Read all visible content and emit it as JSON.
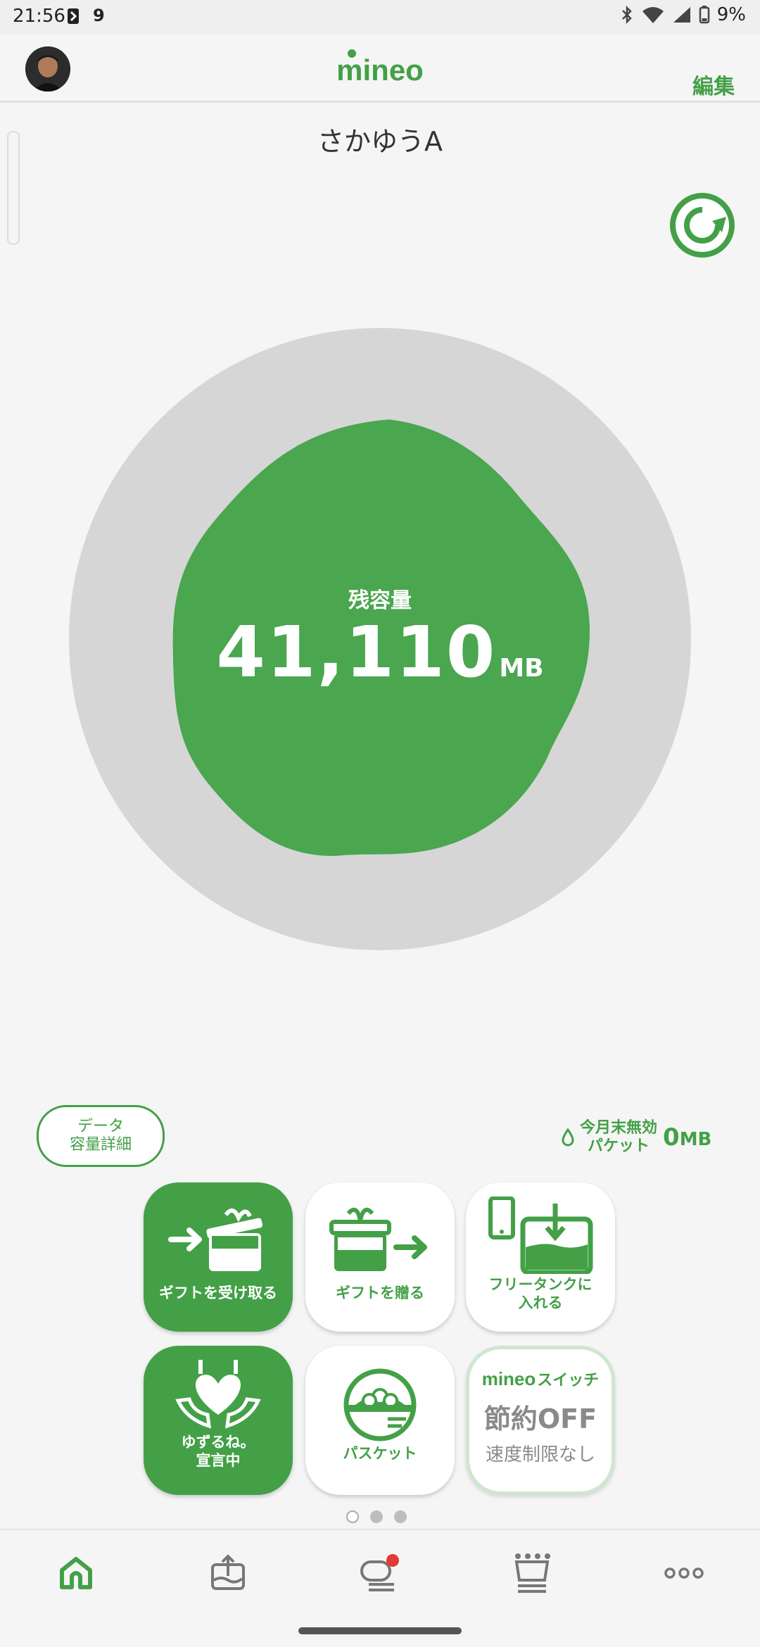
{
  "status_bar": {
    "time": "21:56",
    "notification_count": "9",
    "battery_percent": "9%"
  },
  "header": {
    "logo_text": "mineo",
    "edit_label": "編集"
  },
  "line": {
    "name": "さかゆうA"
  },
  "gauge": {
    "label": "残容量",
    "value": "41,110",
    "unit": "MB",
    "colors": {
      "fill": "#4aa64f",
      "ring": "#d6d6d6"
    }
  },
  "detail_button": {
    "line1": "データ",
    "line2": "容量詳細"
  },
  "invalid_packet": {
    "label_line1": "今月末無効",
    "label_line2": "パケット",
    "value": "0",
    "unit": "MB"
  },
  "tiles": [
    {
      "label": "ギフトを受け取る",
      "style": "green",
      "icon": "gift-receive-icon"
    },
    {
      "label": "ギフトを贈る",
      "style": "white",
      "icon": "gift-send-icon"
    },
    {
      "label_line1": "フリータンクに",
      "label_line2": "入れる",
      "style": "white",
      "icon": "free-tank-icon"
    },
    {
      "label_line1": "ゆずるね。",
      "label_line2": "宣言中",
      "style": "green",
      "icon": "heart-hands-icon"
    },
    {
      "label": "パスケット",
      "style": "white",
      "icon": "basket-icon"
    },
    {
      "logo": "mineo",
      "title": "スイッチ",
      "main": "節約OFF",
      "sub": "速度制限なし",
      "style": "switch"
    }
  ],
  "pagination": {
    "active_index": 0,
    "count": 3
  },
  "bottom_nav": [
    {
      "name": "home",
      "icon": "home-icon",
      "active": true
    },
    {
      "name": "share",
      "icon": "upload-tank-icon",
      "active": false
    },
    {
      "name": "chat",
      "icon": "chat-icon",
      "active": false,
      "badge": true
    },
    {
      "name": "ranking",
      "icon": "crown-icon",
      "active": false
    },
    {
      "name": "more",
      "icon": "more-icon",
      "active": false
    }
  ],
  "accent_color": "#43a047"
}
